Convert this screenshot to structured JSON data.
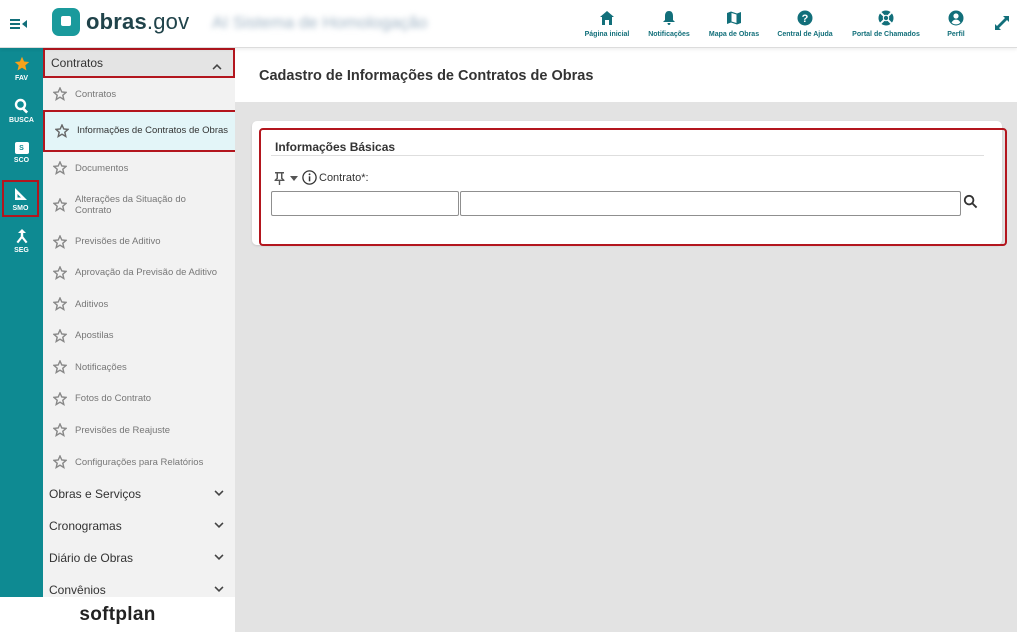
{
  "app": {
    "logo_text": "obras",
    "logo_suffix": ".gov",
    "blurred_title": "AI Sistema de Homologação"
  },
  "topnav": {
    "items": [
      {
        "label": "Página inicial",
        "icon": "home-icon"
      },
      {
        "label": "Notificações",
        "icon": "bell-icon"
      },
      {
        "label": "Mapa de Obras",
        "icon": "map-icon"
      },
      {
        "label": "Central de Ajuda",
        "icon": "help-icon"
      },
      {
        "label": "Portal de Chamados",
        "icon": "lifebuoy-icon"
      },
      {
        "label": "Perfil",
        "icon": "user-icon"
      }
    ]
  },
  "rail": {
    "items": [
      {
        "label": "FAV",
        "icon": "star-icon"
      },
      {
        "label": "BUSCA",
        "icon": "search-icon"
      },
      {
        "label": "SCO",
        "icon": "sco-icon"
      },
      {
        "label": "SMO",
        "icon": "ruler-square-icon"
      },
      {
        "label": "SEG",
        "icon": "merge-icon"
      }
    ],
    "sco_badge": "S"
  },
  "sidebar": {
    "open_group": "Contratos",
    "subitems": [
      "Contratos",
      "Informações de Contratos de Obras",
      "Documentos",
      "Alterações da Situação do Contrato",
      "Previsões de Aditivo",
      "Aprovação da Previsão de Aditivo",
      "Aditivos",
      "Apostilas",
      "Notificações",
      "Fotos do Contrato",
      "Previsões de Reajuste",
      "Configurações para Relatórios"
    ],
    "groups": [
      "Obras e Serviços",
      "Cronogramas",
      "Diário de Obras",
      "Convênios"
    ]
  },
  "footer": {
    "brand": "softplan"
  },
  "main": {
    "title": "Cadastro de Informações de Contratos de Obras",
    "section_title": "Informações Básicas",
    "field_label": "Contrato*:",
    "code_value": "",
    "desc_value": ""
  },
  "colors": {
    "rail": "#0e8a92",
    "brand_dark": "#126f7a",
    "highlight": "#b3161e",
    "active_item_bg": "#e3f5f8",
    "fav_star": "#f7a21b"
  }
}
